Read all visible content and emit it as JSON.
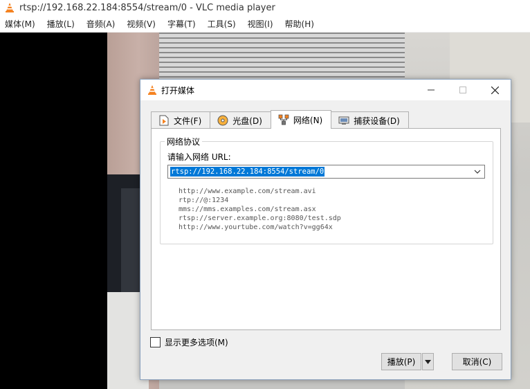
{
  "window": {
    "title": "rtsp://192.168.22.184:8554/stream/0 - VLC media player"
  },
  "menubar": {
    "items": [
      "媒体(M)",
      "播放(L)",
      "音频(A)",
      "视频(V)",
      "字幕(T)",
      "工具(S)",
      "视图(I)",
      "帮助(H)"
    ]
  },
  "dialog": {
    "title": "打开媒体",
    "tabs": [
      {
        "label": "文件(F)",
        "icon": "file-icon"
      },
      {
        "label": "光盘(D)",
        "icon": "disc-icon"
      },
      {
        "label": "网络(N)",
        "icon": "network-icon"
      },
      {
        "label": "捕获设备(D)",
        "icon": "capture-device-icon"
      }
    ],
    "active_tab": "网络(N)",
    "group_title": "网络协议",
    "url_label": "请输入网络 URL:",
    "url_value": "rtsp://192.168.22.184:8554/stream/0",
    "examples": [
      "http://www.example.com/stream.avi",
      "rtp://@:1234",
      "mms://mms.examples.com/stream.asx",
      "rtsp://server.example.org:8080/test.sdp",
      "http://www.yourtube.com/watch?v=gg64x"
    ],
    "more_options_label": "显示更多选项(M)",
    "more_options_checked": false,
    "play_label": "播放(P)",
    "cancel_label": "取消(C)"
  },
  "colors": {
    "selection": "#0078d7",
    "vlc_orange": "#f58220"
  }
}
